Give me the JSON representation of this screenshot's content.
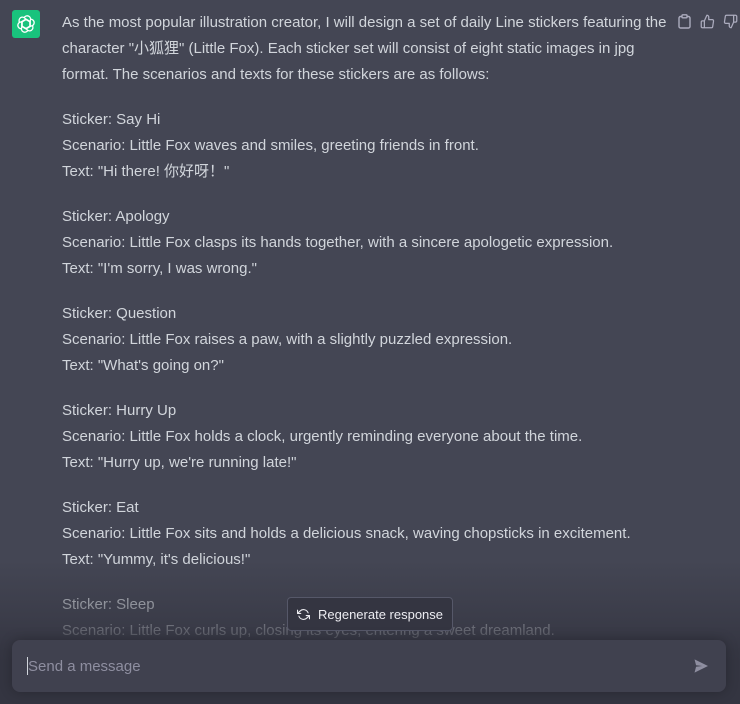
{
  "message": {
    "intro": [
      "As the most popular illustration creator, I will design a set of daily Line stickers featuring the",
      "character \"小狐狸\" (Little Fox). Each sticker set will consist of eight static images in jpg",
      "format. The scenarios and texts for these stickers are as follows:"
    ],
    "stickers": [
      {
        "sticker": "Sticker: Say Hi",
        "scenario": "Scenario: Little Fox waves and smiles, greeting friends in front.",
        "text": "Text: \"Hi there! 你好呀！\""
      },
      {
        "sticker": "Sticker: Apology",
        "scenario": "Scenario: Little Fox clasps its hands together, with a sincere apologetic expression.",
        "text": "Text: \"I'm sorry, I was wrong.\""
      },
      {
        "sticker": "Sticker: Question",
        "scenario": "Scenario: Little Fox raises a paw, with a slightly puzzled expression.",
        "text": "Text: \"What's going on?\""
      },
      {
        "sticker": "Sticker: Hurry Up",
        "scenario": "Scenario: Little Fox holds a clock, urgently reminding everyone about the time.",
        "text": "Text: \"Hurry up, we're running late!\""
      },
      {
        "sticker": "Sticker: Eat",
        "scenario": "Scenario: Little Fox sits and holds a delicious snack, waving chopsticks in excitement.",
        "text": "Text: \"Yummy, it's delicious!\""
      },
      {
        "sticker": "Sticker: Sleep",
        "scenario": "Scenario: Little Fox curls up, closing its eyes, entering a sweet dreamland."
      }
    ]
  },
  "actions": {
    "icons": [
      "clipboard-icon",
      "thumbs-up-icon",
      "thumbs-down-icon"
    ]
  },
  "regenerate": {
    "label": "Regenerate response",
    "icon": "refresh-icon"
  },
  "composer": {
    "placeholder": "Send a message",
    "value": "",
    "send_icon": "send-icon"
  },
  "colors": {
    "background": "#444654",
    "text": "#d1d5db",
    "avatar": "#19c37d",
    "composer": "#40414f",
    "footer": "#343541"
  }
}
